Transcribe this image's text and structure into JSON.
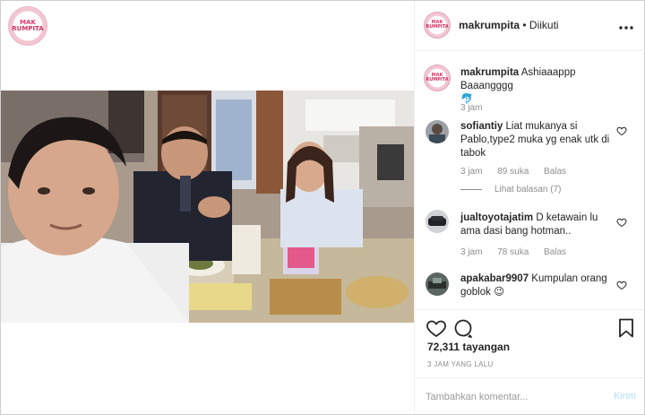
{
  "post": {
    "username": "makrumpita",
    "separator": "•",
    "follow_status": "Diikuti",
    "logo_line1": "MAK",
    "logo_line2": "RUMPITA"
  },
  "caption": {
    "username": "makrumpita",
    "text": "Ashiaaappp Baaangggg",
    "emoji": "🐬",
    "time": "3 jam"
  },
  "comments": [
    {
      "username": "sofiantiy",
      "text": "Liat mukanya si Pablo,type2 muka yg enak utk di tabok",
      "time": "3 jam",
      "likes": "89 suka",
      "reply": "Balas",
      "view_replies": "Lihat balasan (7)"
    },
    {
      "username": "jualtoyotajatim",
      "text": "D ketawain lu ama dasi bang hotman..",
      "time": "3 jam",
      "likes": "78 suka",
      "reply": "Balas"
    },
    {
      "username": "apakabar9907",
      "text": "Kumpulan orang goblok",
      "emoji": "😉"
    }
  ],
  "stats": {
    "views": "72,311 tayangan",
    "posted_ago": "3 JAM YANG LALU"
  },
  "compose": {
    "placeholder": "Tambahkan komentar...",
    "post_label": "Kirim"
  },
  "icons": {
    "more": "more-horizontal-icon",
    "like": "heart-icon",
    "comment": "comment-bubble-icon",
    "bookmark": "bookmark-icon"
  },
  "colors": {
    "accent_link": "#b2dffc",
    "logo_pink": "#e5396a",
    "meta_gray": "#8e8e8e"
  }
}
